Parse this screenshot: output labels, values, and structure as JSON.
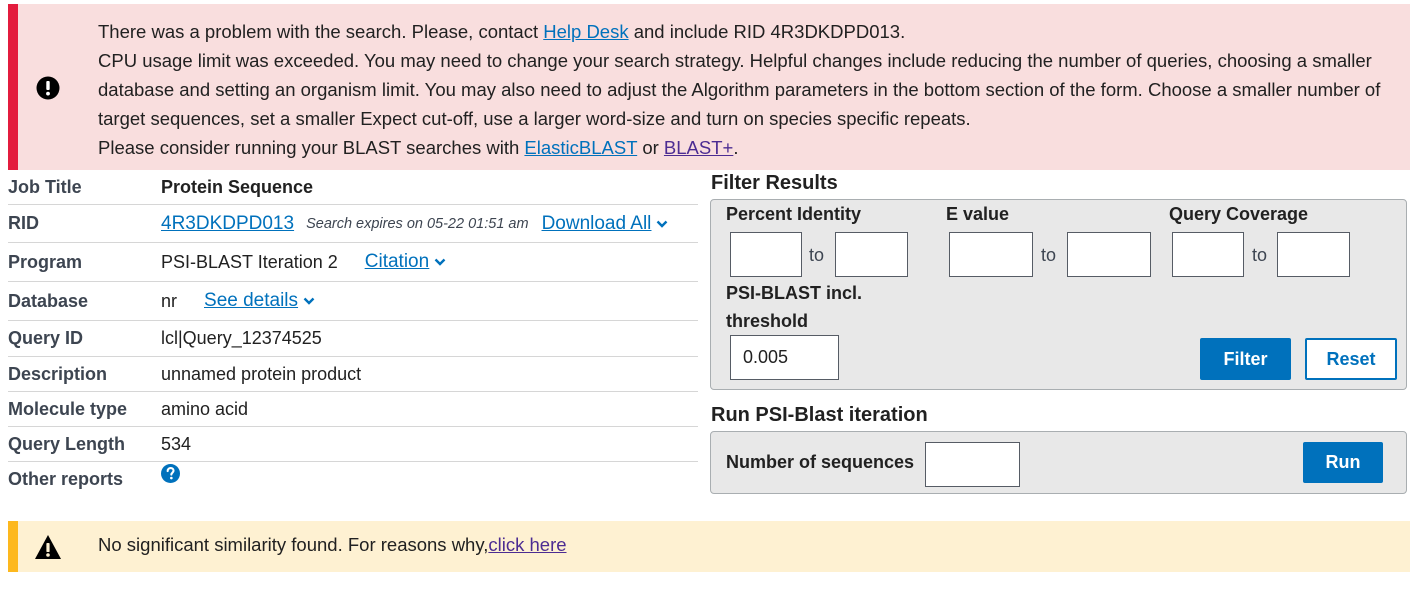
{
  "error_alert": {
    "line1_pre": "There was a problem with the search. Please, contact ",
    "help_desk_link": "Help Desk",
    "line1_post": " and include RID 4R3DKDPD013.",
    "line2": "CPU usage limit was exceeded. You may need to change your search strategy. Helpful changes include reducing the number of queries, choosing a smaller database and setting an organism limit. You may also need to adjust the Algorithm parameters in the bottom section of the form. Choose a smaller number of target sequences, set a smaller Expect cut-off, use a larger word-size and turn on species specific repeats.",
    "line3_pre": "Please consider running your BLAST searches with ",
    "elasticblast_link": "ElasticBLAST",
    "line3_mid": " or ",
    "blastplus_link": "BLAST+",
    "line3_post": ".",
    "icon": "exclamation-circle-icon"
  },
  "summary": {
    "job_title": {
      "label": "Job Title",
      "value": "Protein Sequence"
    },
    "rid": {
      "label": "RID",
      "value": "4R3DKDPD013",
      "expires": "Search expires on 05-22 01:51 am",
      "download": "Download All"
    },
    "program": {
      "label": "Program",
      "value": "PSI-BLAST Iteration 2",
      "citation": "Citation"
    },
    "database": {
      "label": "Database",
      "value": "nr",
      "details": "See details"
    },
    "query_id": {
      "label": "Query ID",
      "value": "lcl|Query_12374525"
    },
    "description": {
      "label": "Description",
      "value": "unnamed protein product"
    },
    "molecule_type": {
      "label": "Molecule type",
      "value": "amino acid"
    },
    "query_length": {
      "label": "Query Length",
      "value": "534"
    },
    "other_reports": {
      "label": "Other reports",
      "icon": "help-circle-icon"
    }
  },
  "filter": {
    "title": "Filter Results",
    "percent_identity": "Percent Identity",
    "e_value": "E value",
    "query_coverage": "Query Coverage",
    "to": "to",
    "psi_threshold_line1": "PSI-BLAST incl.",
    "psi_threshold_line2": "threshold",
    "threshold_value": "0.005",
    "filter_button": "Filter",
    "reset_button": "Reset"
  },
  "run": {
    "title": "Run PSI-Blast iteration",
    "num_sequences_label": "Number of sequences",
    "run_button": "Run"
  },
  "warning_alert": {
    "text": "No significant similarity found. For reasons why,",
    "link": "click here",
    "icon": "warning-triangle-icon"
  },
  "colors": {
    "error_bg": "#f9dede",
    "error_border": "#e31c3d",
    "warn_bg": "#fef1d2",
    "warn_border": "#fdb81e",
    "primary": "#0071bc"
  }
}
